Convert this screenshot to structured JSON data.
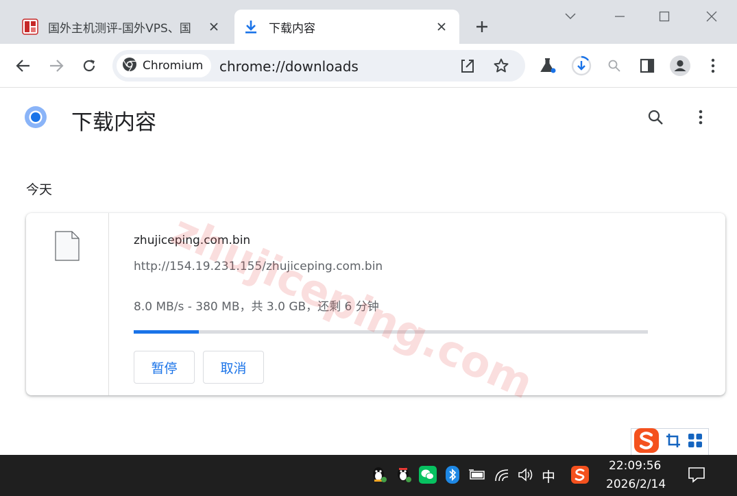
{
  "tabs": [
    {
      "title": "国外主机测评-国外VPS、国",
      "favicon": "site-favicon",
      "active": false
    },
    {
      "title": "下载内容",
      "favicon": "download-icon",
      "active": true
    }
  ],
  "toolbar": {
    "site_chip_label": "Chromium",
    "url": "chrome://downloads"
  },
  "page": {
    "title": "下载内容",
    "date_group": "今天"
  },
  "download": {
    "file_name": "zhujiceping.com.bin",
    "url": "http://154.19.231.155/zhujiceping.com.bin",
    "status": "8.0 MB/s - 380 MB，共 3.0 GB，还剩 6 分钟",
    "progress": 0.1267,
    "pause_label": "暂停",
    "cancel_label": "取消"
  },
  "watermark": "zhujiceping.com",
  "taskbar": {
    "ime": "中",
    "time": "22:09:56",
    "date": "2026/2/14"
  },
  "colors": {
    "accent": "#1a73e8",
    "tabstrip": "#dee1e6",
    "omnibox": "#edf0f5",
    "taskbar": "#1f1f1f"
  }
}
